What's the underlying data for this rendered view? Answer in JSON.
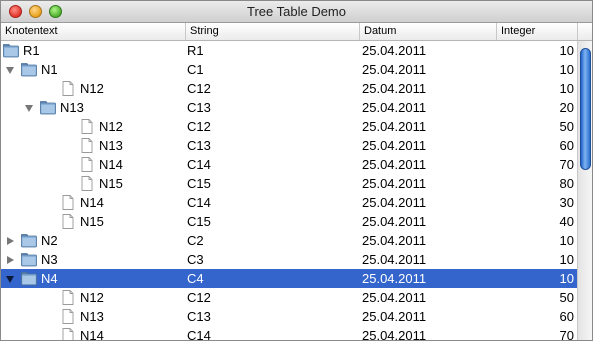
{
  "window": {
    "title": "Tree Table Demo"
  },
  "columns": [
    "Knotentext",
    "String",
    "Datum",
    "Integer"
  ],
  "rows": [
    {
      "label": "R1",
      "string": "R1",
      "date": "25.04.2011",
      "int": "10",
      "level": 0,
      "type": "folder",
      "toggle": "none",
      "selected": false
    },
    {
      "label": "N1",
      "string": "C1",
      "date": "25.04.2011",
      "int": "10",
      "level": 0,
      "type": "folder",
      "toggle": "expanded",
      "selected": false
    },
    {
      "label": "N12",
      "string": "C12",
      "date": "25.04.2011",
      "int": "10",
      "level": 1,
      "type": "file",
      "toggle": "none",
      "selected": false
    },
    {
      "label": "N13",
      "string": "C13",
      "date": "25.04.2011",
      "int": "20",
      "level": 1,
      "type": "folder",
      "toggle": "expanded",
      "selected": false
    },
    {
      "label": "N12",
      "string": "C12",
      "date": "25.04.2011",
      "int": "50",
      "level": 2,
      "type": "file",
      "toggle": "none",
      "selected": false
    },
    {
      "label": "N13",
      "string": "C13",
      "date": "25.04.2011",
      "int": "60",
      "level": 2,
      "type": "file",
      "toggle": "none",
      "selected": false
    },
    {
      "label": "N14",
      "string": "C14",
      "date": "25.04.2011",
      "int": "70",
      "level": 2,
      "type": "file",
      "toggle": "none",
      "selected": false
    },
    {
      "label": "N15",
      "string": "C15",
      "date": "25.04.2011",
      "int": "80",
      "level": 2,
      "type": "file",
      "toggle": "none",
      "selected": false
    },
    {
      "label": "N14",
      "string": "C14",
      "date": "25.04.2011",
      "int": "30",
      "level": 1,
      "type": "file",
      "toggle": "none",
      "selected": false
    },
    {
      "label": "N15",
      "string": "C15",
      "date": "25.04.2011",
      "int": "40",
      "level": 1,
      "type": "file",
      "toggle": "none",
      "selected": false
    },
    {
      "label": "N2",
      "string": "C2",
      "date": "25.04.2011",
      "int": "10",
      "level": 0,
      "type": "folder",
      "toggle": "collapsed",
      "selected": false
    },
    {
      "label": "N3",
      "string": "C3",
      "date": "25.04.2011",
      "int": "10",
      "level": 0,
      "type": "folder",
      "toggle": "collapsed",
      "selected": false
    },
    {
      "label": "N4",
      "string": "C4",
      "date": "25.04.2011",
      "int": "10",
      "level": 0,
      "type": "folder",
      "toggle": "expanded",
      "selected": true
    },
    {
      "label": "N12",
      "string": "C12",
      "date": "25.04.2011",
      "int": "50",
      "level": 1,
      "type": "file",
      "toggle": "none",
      "selected": false
    },
    {
      "label": "N13",
      "string": "C13",
      "date": "25.04.2011",
      "int": "60",
      "level": 1,
      "type": "file",
      "toggle": "none",
      "selected": false
    },
    {
      "label": "N14",
      "string": "C14",
      "date": "25.04.2011",
      "int": "70",
      "level": 1,
      "type": "file",
      "toggle": "none",
      "selected": false
    }
  ],
  "colors": {
    "selection": "#3465cc",
    "folder": "#7fa8d0",
    "scroll_thumb": "#2a6fd0"
  }
}
